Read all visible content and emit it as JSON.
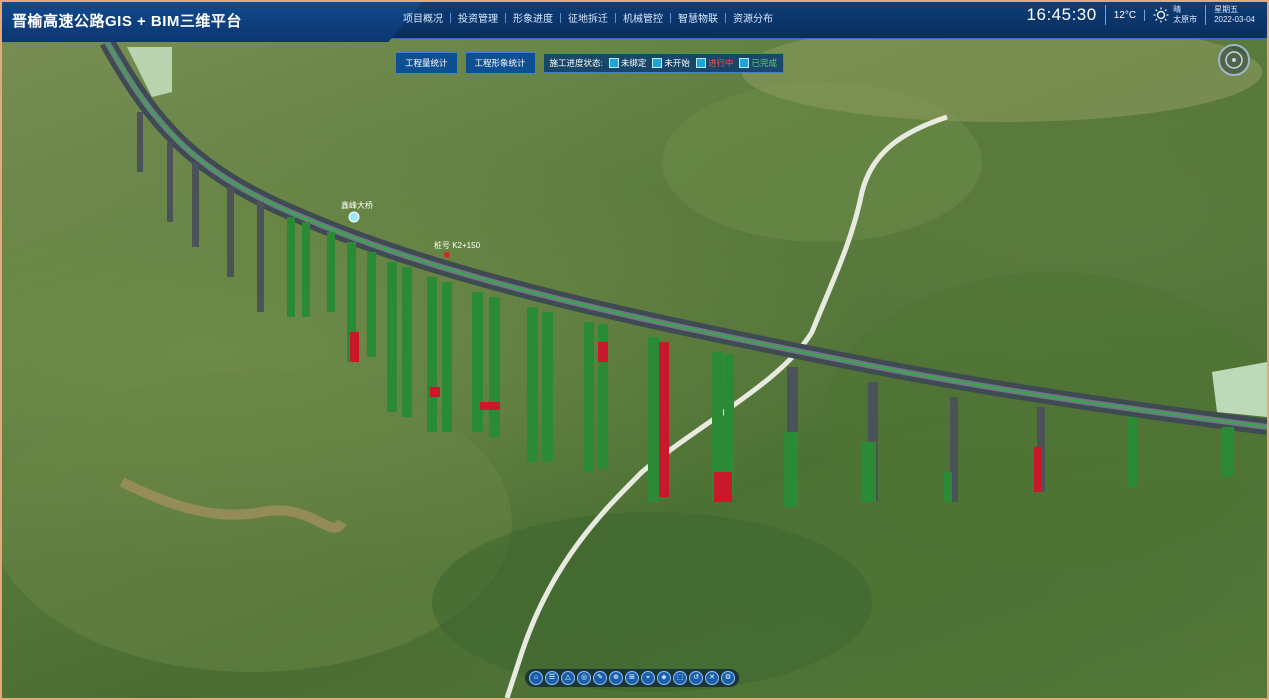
{
  "header": {
    "title": "晋榆高速公路GIS + BIM三维平台",
    "nav": [
      "项目概况",
      "投资管理",
      "形象进度",
      "征地拆迁",
      "机械管控",
      "智慧物联",
      "资源分布"
    ],
    "clock": "16:45:30",
    "temperature": "12°C",
    "weather": {
      "condition": "晴",
      "city": "太原市"
    },
    "date": {
      "weekday": "星期五",
      "date": "2022-03-04"
    }
  },
  "toolbar": {
    "btn_stats": "工程量统计",
    "btn_progress_stats": "工程形象统计",
    "legend_title": "施工进度状态:",
    "legend": [
      {
        "label": "未绑定",
        "color": "#ffffff"
      },
      {
        "label": "未开始",
        "color": "#ffffff"
      },
      {
        "label": "进行中",
        "color": "#ff4a4a"
      },
      {
        "label": "已完成",
        "color": "#5bd36b"
      }
    ]
  },
  "map_labels": {
    "poi": "鑫峰大桥",
    "marker": "桩号 K2+150"
  },
  "bottom_tools": [
    "⌂",
    "☰",
    "△",
    "◎",
    "✎",
    "⊕",
    "⊞",
    "⌖",
    "◈",
    "⬚",
    "↺",
    "✕",
    "⚙"
  ],
  "colors": {
    "header_bg": "#0d3d78",
    "accent": "#1fa3d8",
    "done": "#2aa83a",
    "in_progress": "#c8182a"
  }
}
